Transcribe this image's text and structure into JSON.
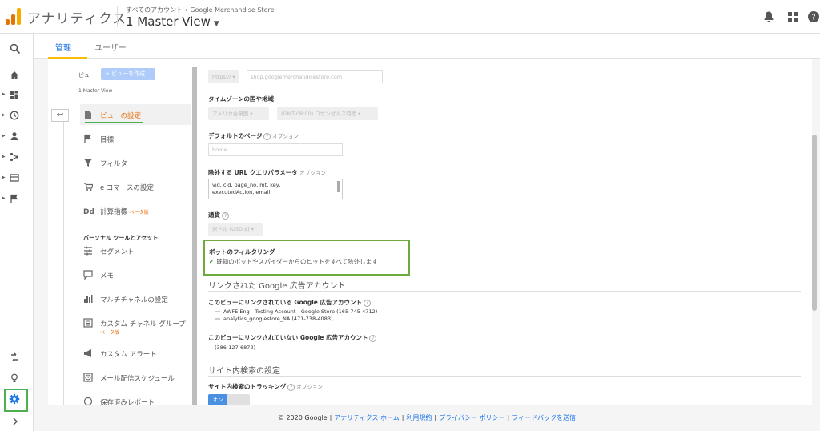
{
  "header": {
    "app_name": "アナリティクス",
    "breadcrumb_all": "すべてのアカウント",
    "breadcrumb_property": "Google Merchandise Store",
    "view_name": "1 Master View",
    "logo_colors": [
      "#f9ab00",
      "#e37400",
      "#e37400"
    ]
  },
  "tabs": [
    {
      "label": "管理"
    },
    {
      "label": "ユーザー"
    }
  ],
  "view_column": {
    "view_label": "ビュー",
    "create_view": "+ ビューを作成",
    "current_view": "1 Master View",
    "items": [
      {
        "label": "ビューの設定",
        "icon": "document-icon"
      },
      {
        "label": "目標",
        "icon": "flag-icon"
      },
      {
        "label": "フィルタ",
        "icon": "filter-icon"
      },
      {
        "label": "e コマースの設定",
        "icon": "cart-icon"
      },
      {
        "label": "計算指標",
        "badge": "ベータ版",
        "icon": "dd-icon"
      },
      {
        "label": "セグメント",
        "icon": "segment-icon"
      },
      {
        "label": "メモ",
        "icon": "annotation-icon"
      },
      {
        "label": "マルチチャネルの設定",
        "icon": "bars-icon"
      },
      {
        "label": "カスタム チャネル グループ",
        "badge": "ベータ版",
        "icon": "channel-icon"
      },
      {
        "label": "カスタム アラート",
        "icon": "megaphone-icon"
      },
      {
        "label": "メール配信スケジュール",
        "icon": "clock-icon"
      },
      {
        "label": "保存済みレポート",
        "icon": "saved-icon"
      }
    ],
    "personal_tools_heading": "パーソナル ツールとアセット"
  },
  "settings": {
    "protocol": "https://",
    "website_url": "shop.googlemerchandisestore.com",
    "timezone_label": "タイムゾーンの国や地域",
    "timezone_country": "アメリカ合衆国",
    "timezone_value": "(GMT-08:00) ロサンゼルス時間",
    "default_page_label": "デフォルトのページ",
    "default_page_optional": "オプション",
    "default_page_value": "home",
    "exclude_params_label": "除外する URL クエリパラメータ",
    "exclude_params_optional": "オプション",
    "exclude_params_line1": "vid, cid, page_no, mt, key,",
    "exclude_params_line2": "executedAction, email,",
    "currency_label": "通貨",
    "currency_value": "米ドル (USD $)",
    "bot_filter_label": "ボットのフィルタリング",
    "bot_filter_desc": "既知のボットやスパイダーからのヒットをすべて除外します",
    "linked_ads_heading": "リンクされた Google 広告アカウント",
    "linked_label": "このビューにリンクされている Google 広告アカウント",
    "linked_accounts": [
      "AWFE Eng - Testing Account - Google Store (165-745-4712)",
      "analytics_googlestore_NA (471-738-4083)"
    ],
    "unlinked_label": "このビューにリンクされていない Google 広告アカウント",
    "unlinked_accounts": [
      "(386-127-6872)"
    ],
    "site_search_heading": "サイト内検索の設定",
    "site_search_tracking_label": "サイト内検索のトラッキング",
    "site_search_optional": "オプション",
    "toggle_on": "オン"
  },
  "footer": {
    "copyright": "© 2020 Google",
    "links": [
      "アナリティクス ホーム",
      "利用規約",
      "プライバシー ポリシー",
      "フィードバックを送信"
    ]
  }
}
